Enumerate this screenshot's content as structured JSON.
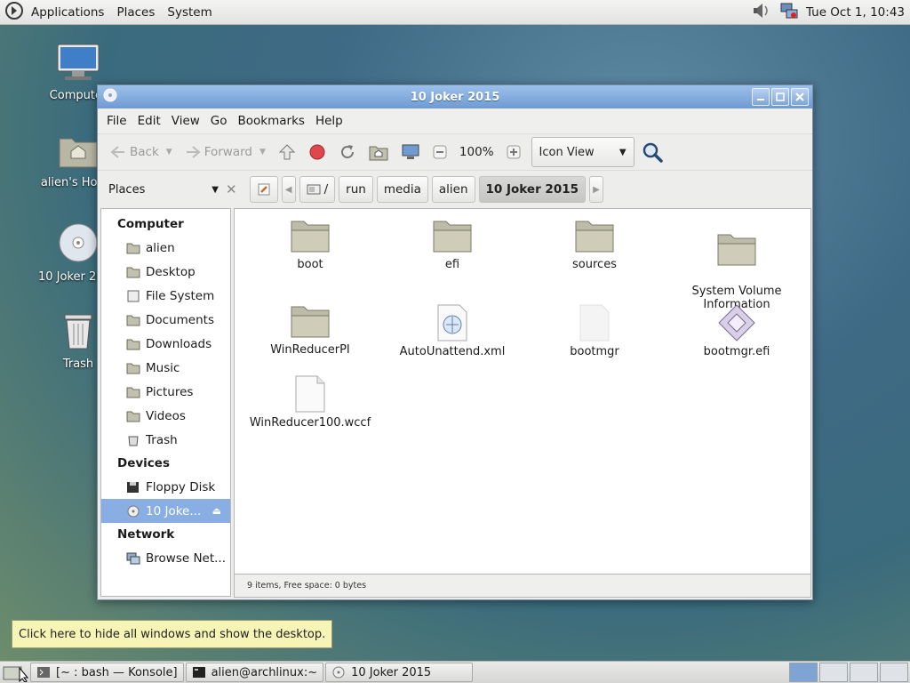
{
  "top_panel": {
    "menu": [
      "Applications",
      "Places",
      "System"
    ],
    "clock": "Tue Oct  1, 10:43"
  },
  "desktop": {
    "icons": [
      {
        "label": "Computer"
      },
      {
        "label": "alien's Home"
      },
      {
        "label": "10 Joker 2015"
      },
      {
        "label": "Trash"
      }
    ]
  },
  "window": {
    "title": "10 Joker 2015",
    "menu": [
      "File",
      "Edit",
      "View",
      "Go",
      "Bookmarks",
      "Help"
    ],
    "toolbar": {
      "back": "Back",
      "forward": "Forward",
      "zoom": "100%",
      "view_mode": "Icon View"
    },
    "location": {
      "places_label": "Places",
      "crumbs": [
        "/",
        "run",
        "media",
        "alien",
        "10 Joker 2015"
      ]
    },
    "sidebar": {
      "sections": [
        {
          "heading": "Computer",
          "items": [
            "alien",
            "Desktop",
            "File System",
            "Documents",
            "Downloads",
            "Music",
            "Pictures",
            "Videos",
            "Trash"
          ]
        },
        {
          "heading": "Devices",
          "items": [
            "Floppy Disk",
            "10 Joke..."
          ]
        },
        {
          "heading": "Network",
          "items": [
            "Browse Net..."
          ]
        }
      ],
      "selected": "10 Joke..."
    },
    "files": [
      {
        "name": "boot",
        "type": "folder"
      },
      {
        "name": "efi",
        "type": "folder"
      },
      {
        "name": "sources",
        "type": "folder"
      },
      {
        "name": "System Volume\nInformation",
        "type": "folder"
      },
      {
        "name": "WinReducerPI",
        "type": "folder"
      },
      {
        "name": "AutoUnattend.xml",
        "type": "xml"
      },
      {
        "name": "bootmgr",
        "type": "blank"
      },
      {
        "name": "bootmgr.efi",
        "type": "efi"
      },
      {
        "name": "WinReducer100.wccf",
        "type": "doc"
      }
    ],
    "status": "9 items, Free space: 0 bytes"
  },
  "tooltip": "Click here to hide all windows and show the desktop.",
  "taskbar": {
    "tasks": [
      "[~ : bash — Konsole]",
      "alien@archlinux:~",
      "10 Joker 2015"
    ]
  }
}
